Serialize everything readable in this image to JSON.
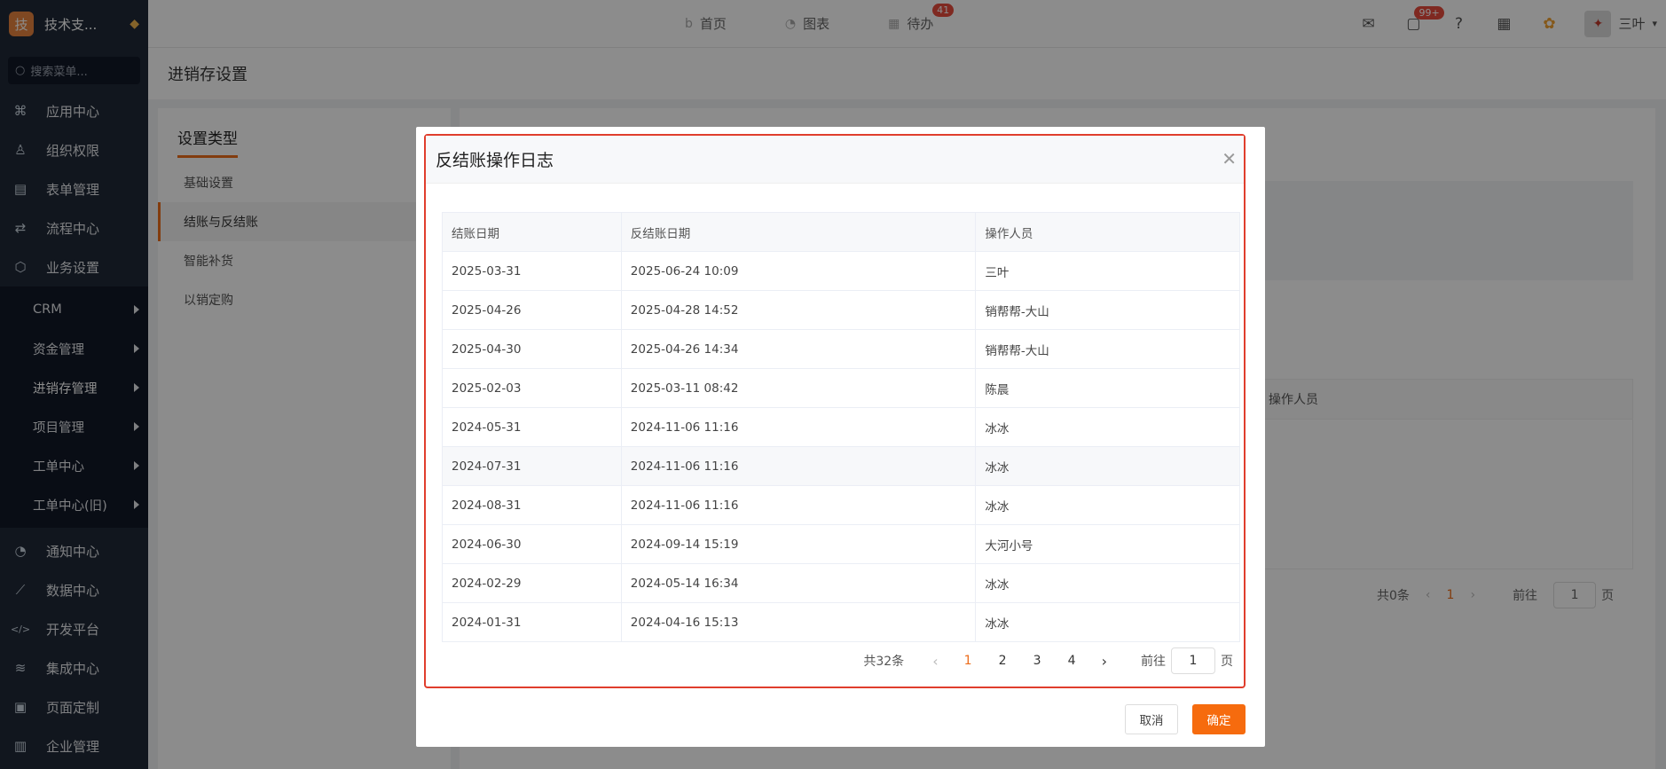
{
  "app": {
    "logo_text": "技",
    "name": "技术支..."
  },
  "search": {
    "placeholder": "搜索菜单..."
  },
  "sidebar": {
    "items_top": [
      {
        "label": "应用中心",
        "icon": "grid-icon"
      },
      {
        "label": "组织权限",
        "icon": "user-icon"
      },
      {
        "label": "表单管理",
        "icon": "document-icon"
      },
      {
        "label": "流程中心",
        "icon": "flow-icon"
      },
      {
        "label": "业务设置",
        "icon": "cube-icon"
      }
    ],
    "sub_items": [
      {
        "label": "CRM"
      },
      {
        "label": "资金管理"
      },
      {
        "label": "进销存管理"
      },
      {
        "label": "项目管理"
      },
      {
        "label": "工单中心"
      },
      {
        "label": "工单中心(旧)"
      }
    ],
    "items_bottom": [
      {
        "label": "通知中心",
        "icon": "bell-icon"
      },
      {
        "label": "数据中心",
        "icon": "chart-icon"
      },
      {
        "label": "开发平台",
        "icon": "code-icon"
      },
      {
        "label": "集成中心",
        "icon": "layers-icon"
      },
      {
        "label": "页面定制",
        "icon": "layout-icon"
      },
      {
        "label": "企业管理",
        "icon": "building-icon"
      }
    ]
  },
  "topbar": {
    "tabs": [
      {
        "label": "首页",
        "icon": "b"
      },
      {
        "label": "图表",
        "icon": "◔"
      },
      {
        "label": "待办",
        "icon": "▦",
        "badge": "41"
      }
    ],
    "message_badge": "99+",
    "user_name": "三叶"
  },
  "page": {
    "title": "进销存设置"
  },
  "settings_panel": {
    "title": "设置类型",
    "items": [
      "基础设置",
      "结账与反结账",
      "智能补货",
      "以销定购"
    ],
    "active_index": 1
  },
  "background": {
    "column_header": "操作人员",
    "pager": {
      "total": "共0条",
      "current": "1",
      "goto_label": "前往",
      "goto_value": "1",
      "unit": "页"
    }
  },
  "dialog": {
    "title": "反结账操作日志",
    "columns": [
      "结账日期",
      "反结账日期",
      "操作人员"
    ],
    "rows": [
      [
        "2025-03-31",
        "2025-06-24 10:09",
        "三叶"
      ],
      [
        "2025-04-26",
        "2025-04-28 14:52",
        "销帮帮-大山"
      ],
      [
        "2025-04-30",
        "2025-04-26 14:34",
        "销帮帮-大山"
      ],
      [
        "2025-02-03",
        "2025-03-11 08:42",
        "陈晨"
      ],
      [
        "2024-05-31",
        "2024-11-06 11:16",
        "冰冰"
      ],
      [
        "2024-07-31",
        "2024-11-06 11:16",
        "冰冰"
      ],
      [
        "2024-08-31",
        "2024-11-06 11:16",
        "冰冰"
      ],
      [
        "2024-06-30",
        "2024-09-14 15:19",
        "大河小号"
      ],
      [
        "2024-02-29",
        "2024-05-14 16:34",
        "冰冰"
      ],
      [
        "2024-01-31",
        "2024-04-16 15:13",
        "冰冰"
      ]
    ],
    "highlighted_row": 5,
    "pager": {
      "total": "共32条",
      "pages": [
        "1",
        "2",
        "3",
        "4"
      ],
      "current": "1",
      "goto_label": "前往",
      "goto_value": "1",
      "unit": "页"
    },
    "cancel_label": "取消",
    "ok_label": "确定"
  },
  "colors": {
    "accent": "#f66b0e",
    "sidebar_bg": "#1f2937",
    "highlight_border": "#e03e2d"
  }
}
